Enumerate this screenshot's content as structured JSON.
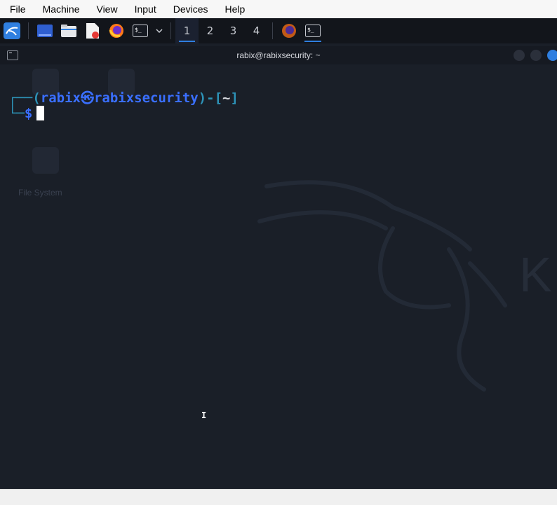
{
  "host_menu": {
    "items": [
      "File",
      "Machine",
      "View",
      "Input",
      "Devices",
      "Help"
    ]
  },
  "panel": {
    "workspaces": [
      "1",
      "2",
      "3",
      "4"
    ],
    "active_workspace": "1",
    "launchers": [
      "kali-menu-icon",
      "desktop-icon",
      "file-manager-icon",
      "text-editor-icon",
      "firefox-icon",
      "terminal-icon",
      "chevron-down-icon"
    ],
    "tasks": [
      "firefox-icon",
      "terminal-icon"
    ]
  },
  "desktop": {
    "icon_label": "File System"
  },
  "terminal": {
    "title": "rabix@rabixsecurity: ~",
    "prompt": {
      "top_prefix": "┌──(",
      "user": "rabix",
      "at_symbol": "㉿",
      "host": "rabixsecurity",
      "mid": ")-[",
      "dir": "~",
      "close": "]",
      "bottom_prefix": "└─",
      "dollar": "$"
    }
  },
  "colors": {
    "accent": "#2f7fe0",
    "prompt_blue": "#3a6fff",
    "prompt_cyan": "#2d93b8",
    "background": "#1a1f28"
  }
}
